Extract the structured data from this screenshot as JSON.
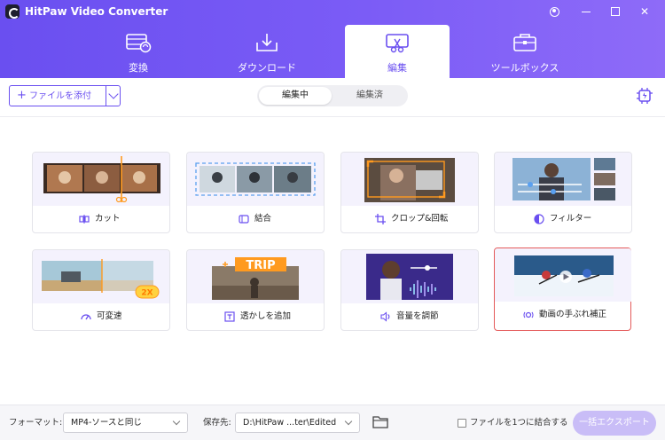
{
  "app": {
    "title": "HitPaw Video Converter"
  },
  "tabs": [
    {
      "label": "変換"
    },
    {
      "label": "ダウンロード"
    },
    {
      "label": "編集"
    },
    {
      "label": "ツールボックス"
    }
  ],
  "toolbar": {
    "add_file_label": "ファイルを添付",
    "segments": [
      {
        "label": "編集中"
      },
      {
        "label": "編集済"
      }
    ]
  },
  "cards": [
    {
      "label": "カット",
      "icon": "scissors-icon"
    },
    {
      "label": "結合",
      "icon": "merge-icon"
    },
    {
      "label": "クロップ&回転",
      "icon": "crop-icon"
    },
    {
      "label": "フィルター",
      "icon": "filter-icon"
    },
    {
      "label": "可変速",
      "icon": "speedometer-icon",
      "badge": "2X"
    },
    {
      "label": "透かしを追加",
      "icon": "watermark-icon",
      "badge": "TRIP"
    },
    {
      "label": "音量を調節",
      "icon": "volume-icon"
    },
    {
      "label": "動画の手ぶれ補正",
      "icon": "stabilize-icon"
    }
  ],
  "bottom": {
    "format_label": "フォーマット:",
    "format_value": "MP4-ソースと同じ",
    "save_label": "保存先:",
    "save_value": "D:\\HitPaw ...ter\\Edited",
    "merge_label": "ファイルを1つに結合する",
    "export_label": "一括エクスポート"
  },
  "colors": {
    "accent": "#6a4ff0",
    "selected_border": "#e45a5a",
    "export_disabled": "#c9bdf7"
  }
}
